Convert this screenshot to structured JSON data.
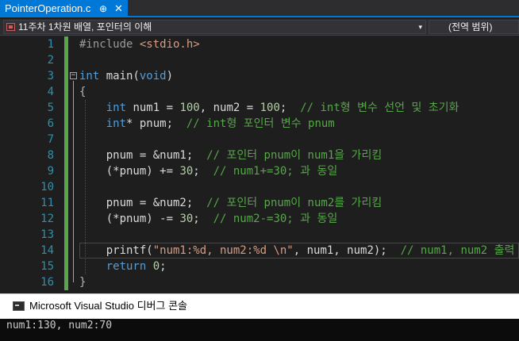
{
  "tab": {
    "title": "PointerOperation.c",
    "pin_glyph": "⊕",
    "close_glyph": "✕"
  },
  "navbar": {
    "scope_text": "11주차 1차원 배열, 포인터의 이해",
    "member_text": "(전역 범위)",
    "chevron": "▾"
  },
  "editor": {
    "line_numbers": [
      "1",
      "2",
      "3",
      "4",
      "5",
      "6",
      "7",
      "8",
      "9",
      "10",
      "11",
      "12",
      "13",
      "14",
      "15",
      "16"
    ],
    "lines": [
      [
        {
          "t": "#include ",
          "c": "pp"
        },
        {
          "t": "<stdio.h>",
          "c": "str"
        }
      ],
      [],
      [
        {
          "t": "int",
          "c": "kw"
        },
        {
          "t": " main(",
          "c": "var"
        },
        {
          "t": "void",
          "c": "kw"
        },
        {
          "t": ")",
          "c": "var"
        }
      ],
      [
        {
          "t": "{",
          "c": "br"
        }
      ],
      [
        {
          "t": "    "
        },
        {
          "t": "int",
          "c": "kw"
        },
        {
          "t": " num1 = ",
          "c": "var"
        },
        {
          "t": "100",
          "c": "num"
        },
        {
          "t": ", num2 = ",
          "c": "var"
        },
        {
          "t": "100",
          "c": "num"
        },
        {
          "t": ";  ",
          "c": "var"
        },
        {
          "t": "// int형 변수 선언 및 초기화",
          "c": "cm"
        }
      ],
      [
        {
          "t": "    "
        },
        {
          "t": "int",
          "c": "kw"
        },
        {
          "t": "* pnum;  ",
          "c": "var"
        },
        {
          "t": "// int형 포인터 변수 pnum",
          "c": "cm"
        }
      ],
      [],
      [
        {
          "t": "    pnum = &num1;  ",
          "c": "var"
        },
        {
          "t": "// 포인터 pnum이 num1을 가리킴",
          "c": "cm"
        }
      ],
      [
        {
          "t": "    (*pnum) += ",
          "c": "var"
        },
        {
          "t": "30",
          "c": "num"
        },
        {
          "t": ";  ",
          "c": "var"
        },
        {
          "t": "// num1+=30; 과 동일",
          "c": "cm"
        }
      ],
      [],
      [
        {
          "t": "    pnum = &num2;  ",
          "c": "var"
        },
        {
          "t": "// 포인터 pnum이 num2를 가리킴",
          "c": "cm"
        }
      ],
      [
        {
          "t": "    (*pnum) -= ",
          "c": "var"
        },
        {
          "t": "30",
          "c": "num"
        },
        {
          "t": ";  ",
          "c": "var"
        },
        {
          "t": "// num2-=30; 과 동일",
          "c": "cm"
        }
      ],
      [],
      [
        {
          "t": "    printf(",
          "c": "var"
        },
        {
          "t": "\"num1:%d, num2:%d \\n\"",
          "c": "str"
        },
        {
          "t": ", num1, num2);  ",
          "c": "var"
        },
        {
          "t": "// num1, num2 출력",
          "c": "cm"
        }
      ],
      [
        {
          "t": "    "
        },
        {
          "t": "return",
          "c": "kw"
        },
        {
          "t": " ",
          "c": "var"
        },
        {
          "t": "0",
          "c": "num"
        },
        {
          "t": ";",
          "c": "var"
        }
      ],
      [
        {
          "t": "}",
          "c": "br"
        }
      ]
    ]
  },
  "console": {
    "title": "Microsoft Visual Studio 디버그 콘솔",
    "output": "num1:130, num2:70"
  }
}
